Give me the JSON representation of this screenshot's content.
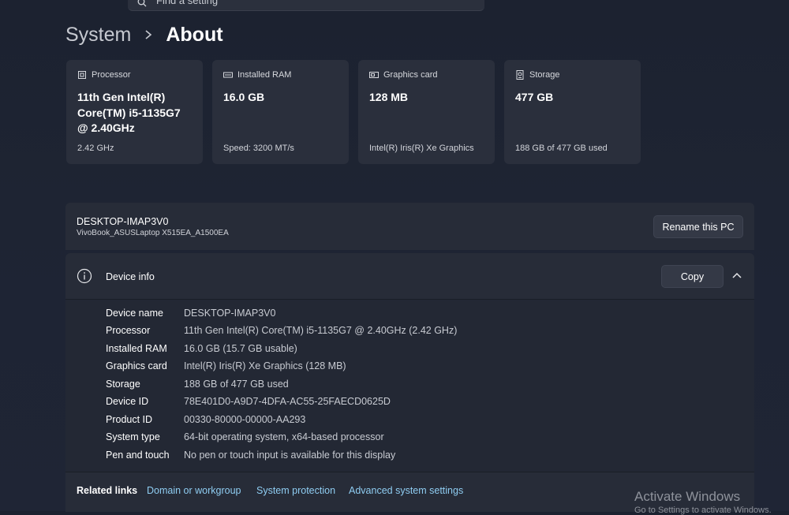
{
  "search": {
    "placeholder": "Find a setting"
  },
  "breadcrumb": {
    "parent": "System",
    "current": "About"
  },
  "cards": [
    {
      "title": "Processor",
      "value": "11th Gen Intel(R) Core(TM) i5-1135G7 @ 2.40GHz",
      "sub": "2.42 GHz",
      "icon": "processor-icon"
    },
    {
      "title": "Installed RAM",
      "value": "16.0 GB",
      "sub": "Speed: 3200 MT/s",
      "icon": "ram-icon"
    },
    {
      "title": "Graphics card",
      "value": "128 MB",
      "sub": "Intel(R) Iris(R) Xe Graphics",
      "icon": "graphics-card-icon"
    },
    {
      "title": "Storage",
      "value": "477 GB",
      "sub": "188 GB of 477 GB used",
      "icon": "storage-icon"
    }
  ],
  "pc": {
    "name": "DESKTOP-IMAP3V0",
    "model": "VivoBook_ASUSLaptop X515EA_A1500EA",
    "rename_label": "Rename this PC"
  },
  "device_info": {
    "title": "Device info",
    "copy_label": "Copy",
    "rows": [
      {
        "key": "Device name",
        "value": "DESKTOP-IMAP3V0"
      },
      {
        "key": "Processor",
        "value": "11th Gen Intel(R) Core(TM) i5-1135G7 @ 2.40GHz (2.42 GHz)"
      },
      {
        "key": "Installed RAM",
        "value": "16.0 GB (15.7 GB usable)"
      },
      {
        "key": "Graphics card",
        "value": "Intel(R) Iris(R) Xe Graphics (128 MB)"
      },
      {
        "key": "Storage",
        "value": "188 GB of 477 GB used"
      },
      {
        "key": "Device ID",
        "value": "78E401D0-A9D7-4DFA-AC55-25FAECD0625D"
      },
      {
        "key": "Product ID",
        "value": "00330-80000-00000-AA293"
      },
      {
        "key": "System type",
        "value": "64-bit operating system, x64-based processor"
      },
      {
        "key": "Pen and touch",
        "value": "No pen or touch input is available for this display"
      }
    ]
  },
  "related": {
    "label": "Related links",
    "links": [
      "Domain or workgroup",
      "System protection",
      "Advanced system settings"
    ]
  },
  "watermark": {
    "line1": "Activate Windows",
    "line2": "Go to Settings to activate Windows."
  },
  "colors": {
    "link": "#8fcdf2",
    "card_bg": "#2a2f3c",
    "page_bg": "#1e2433"
  }
}
